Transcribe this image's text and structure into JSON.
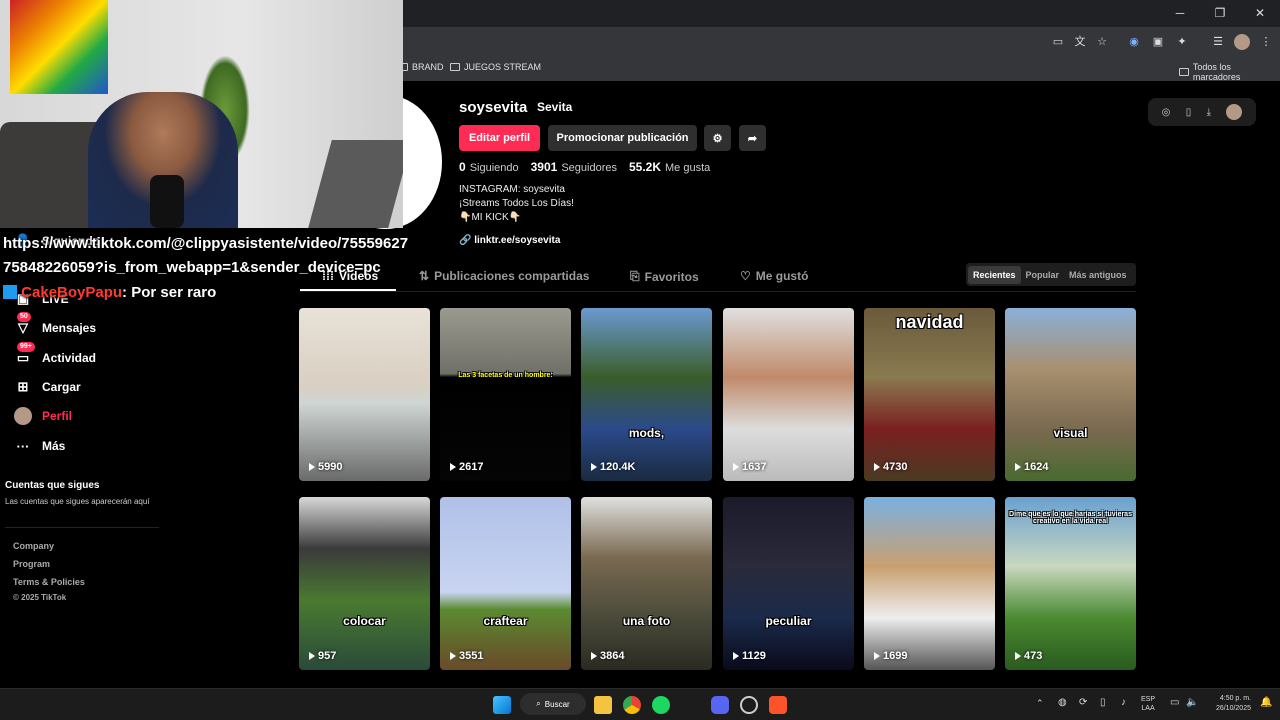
{
  "window_controls": {
    "minimize": "─",
    "restore": "❐",
    "close": "✕"
  },
  "bookmarks": {
    "items": [
      "BRAND",
      "JUEGOS STREAM"
    ],
    "all_label": "Todos los marcadores"
  },
  "overlay": {
    "url_line1": "https://www.tiktok.com/@clippyasistente/video/75559627",
    "url_line2": "75848226059?is_from_webapp=1&sender_device=pc",
    "chat_user": "CakeBoyPapu",
    "chat_message": ": Por ser raro"
  },
  "sidebar": {
    "items": [
      {
        "label": "Siguiendo",
        "icon": "following-icon"
      },
      {
        "label": "LIVE",
        "icon": "live-icon"
      },
      {
        "label": "Mensajes",
        "icon": "messages-icon",
        "badge": "50"
      },
      {
        "label": "Actividad",
        "icon": "activity-icon",
        "badge": "99+"
      },
      {
        "label": "Cargar",
        "icon": "upload-icon"
      },
      {
        "label": "Perfil",
        "icon": "profile-icon"
      },
      {
        "label": "Más",
        "icon": "more-icon"
      }
    ],
    "follow_title": "Cuentas que sigues",
    "follow_desc": "Las cuentas que sigues aparecerán aquí",
    "footer": [
      "Company",
      "Program",
      "Terms & Policies",
      "© 2025 TikTok"
    ]
  },
  "profile": {
    "username": "soysevita",
    "nickname": "Sevita",
    "edit_label": "Editar perfil",
    "promote_label": "Promocionar publicación",
    "stats": [
      {
        "value": "0",
        "label": "Siguiendo"
      },
      {
        "value": "3901",
        "label": "Seguidores"
      },
      {
        "value": "55.2K",
        "label": "Me gusta"
      }
    ],
    "bio": [
      "INSTAGRAM: soysevita",
      "¡Streams Todos Los Días!",
      "👇🏻MI KICK👇🏻"
    ],
    "link": "linktr.ee/soysevita"
  },
  "tabs": [
    "Videos",
    "Publicaciones compartidas",
    "Favoritos",
    "Me gustó"
  ],
  "sort": {
    "options": [
      "Recientes",
      "Popular",
      "Más antiguos"
    ],
    "active": "Recientes"
  },
  "videos": [
    {
      "views": "5990",
      "caption": "",
      "bg": "linear-gradient(180deg,#e8e2d8 0%,#d9cfc2 45%,#cfd6d4 55%,#6a6a6a 100%)"
    },
    {
      "views": "2617",
      "caption": "Las 3 facetas de un hombre:",
      "bg": "linear-gradient(180deg,#9a9a90 0%,#707068 38%,#000 40%,#050505 100%)"
    },
    {
      "views": "120.4K",
      "caption": "mods,",
      "bg": "linear-gradient(180deg,#6a9ad0 0%,#3b5d2a 40%,#2b4a8a 70%,#1a2a40 100%)"
    },
    {
      "views": "1637",
      "caption": "",
      "bg": "linear-gradient(180deg,#e0e0e0 0%,#c08a6a 40%,#ddd 70%,#bbb 100%)"
    },
    {
      "views": "4730",
      "caption": "navidad",
      "bg": "linear-gradient(180deg,#6b5a3a 0%,#8a7a50 40%,#7a2020 70%,#4a3a22 100%)"
    },
    {
      "views": "1624",
      "caption": "visual",
      "bg": "linear-gradient(180deg,#8ab0d8 0%,#a89070 35%,#7a6a50 70%,#4a6a30 100%)"
    },
    {
      "views": "957",
      "caption": "colocar",
      "bg": "linear-gradient(180deg,#d8d8d8 0%,#3a3a3a 30%,#4a7a30 60%,#2a4a3a 100%)"
    },
    {
      "views": "3551",
      "caption": "craftear",
      "bg": "linear-gradient(180deg,#b0c0e8 0%,#c8d4f0 55%,#5a8a30 65%,#6a4a2a 100%)"
    },
    {
      "views": "3864",
      "caption": "una foto",
      "bg": "linear-gradient(180deg,#e0e0e0 0%,#7a6a50 35%,#4a4a3a 70%,#2a2a22 100%)"
    },
    {
      "views": "1129",
      "caption": "peculiar",
      "bg": "linear-gradient(180deg,#1a1a2a 0%,#2a2a3a 40%,#1a2a4a 70%,#0a0a1a 100%)"
    },
    {
      "views": "1699",
      "caption": "",
      "bg": "linear-gradient(180deg,#7ab0e0 0%,#c8a070 40%,#eee 70%,#555 100%)"
    },
    {
      "views": "473",
      "caption": "Dime que es lo que harías si tuvieras creativo en la vida real",
      "bg": "linear-gradient(180deg,#6aa0d0 0%,#c8d8c0 40%,#4a8a30 70%,#2a5a20 100%)"
    }
  ],
  "taskbar": {
    "search_label": "Buscar",
    "lang_line1": "ESP",
    "lang_line2": "LAA",
    "time": "4:50 p. m.",
    "date": "26/10/2025"
  },
  "colors": {
    "accent": "#fe2c55",
    "background": "#000000"
  }
}
